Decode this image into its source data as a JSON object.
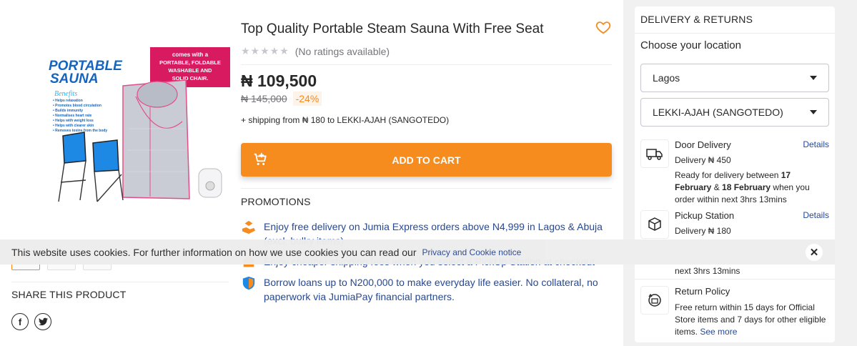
{
  "colors": {
    "accent": "#f68b1e",
    "link": "#264996",
    "text": "#282828"
  },
  "product": {
    "title": "Top Quality Portable Steam Sauna With Free Seat",
    "rating_text": "(No ratings available)",
    "stars": "★★★★★",
    "price": "₦ 109,500",
    "old_price": "₦ 145,000",
    "discount": "-24%",
    "shipping_prefix": "+ shipping from ",
    "shipping_amount": "₦ 180",
    "shipping_suffix": " to LEKKI-AJAH (SANGOTEDO)",
    "add_to_cart": "ADD TO CART",
    "favorite_icon": "heart-icon"
  },
  "image": {
    "headline1": "PORTABLE",
    "headline2": "SAUNA",
    "script": "Benefits",
    "banner_line1": "comes with a",
    "banner_line2": "PORTABLE, FOLDABLE",
    "banner_line3": "WASHABLE AND",
    "banner_line4": "SOLID CHAIR.",
    "benefits": [
      "Helps relaxation",
      "Promotes blood circulation",
      "Builds immunity",
      "Normalises heart rate",
      "Helps with weight loss",
      "Helps with clearer skin",
      "Removes toxins from the body"
    ]
  },
  "share": {
    "title": "SHARE THIS PRODUCT",
    "facebook": "f",
    "twitter": "t"
  },
  "promotions": {
    "title": "PROMOTIONS",
    "item1": "Enjoy free delivery on Jumia Express orders above N4,999 in Lagos & Abuja (excl. bulky items)",
    "item2": "Enjoy cheaper shipping fees when you select a PickUp Station at checkout",
    "item3": "Borrow loans up to N200,000 to make everyday life easier. No collateral, no paperwork via JumiaPay financial partners."
  },
  "cookie": {
    "text": "This website uses cookies. For further information on how we use cookies you can read our",
    "link": "Privacy and Cookie notice",
    "close": "✕"
  },
  "delivery": {
    "header": "DELIVERY & RETURNS",
    "choose": "Choose your location",
    "region": "Lagos",
    "city": "LEKKI-AJAH (SANGOTEDO)",
    "door": {
      "title": "Door Delivery",
      "details": "Details",
      "price": "Delivery ₦ 450",
      "text_pre": "Ready for delivery between ",
      "date1": "17 February",
      "text_mid": " & ",
      "date2": "18 February",
      "text_post": " when you order within next 3hrs 13mins"
    },
    "pickup": {
      "title": "Pickup Station",
      "details": "Details",
      "price": "Delivery ₦ 180",
      "text_tail": "next 3hrs 13mins"
    },
    "returns": {
      "title": "Return Policy",
      "text": "Free return within 15 days for Official Store items and 7 days for other eligible items.",
      "link": "See more"
    }
  }
}
